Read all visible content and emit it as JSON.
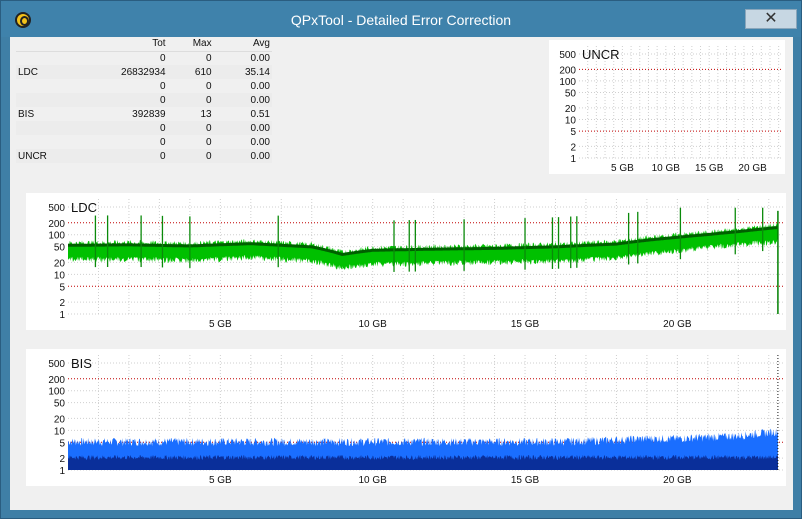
{
  "window": {
    "title": "QPxTool - Detailed Error Correction",
    "close_glyph": "✕",
    "accent": "#3f82ab"
  },
  "stats": {
    "headers": [
      "",
      "Tot",
      "Max",
      "Avg"
    ],
    "rows": [
      [
        "",
        "0",
        "0",
        "0.00"
      ],
      [
        "LDC",
        "26832934",
        "610",
        "35.14"
      ],
      [
        "",
        "0",
        "0",
        "0.00"
      ],
      [
        "",
        "0",
        "0",
        "0.00"
      ],
      [
        "BIS",
        "392839",
        "13",
        "0.51"
      ],
      [
        "",
        "0",
        "0",
        "0.00"
      ],
      [
        "",
        "0",
        "0",
        "0.00"
      ],
      [
        "UNCR",
        "0",
        "0",
        "0.00"
      ]
    ]
  },
  "chart_data": [
    {
      "type": "area",
      "title": "UNCR",
      "y_scale": "log",
      "ylim": [
        1,
        500
      ],
      "yticks": [
        "500",
        "200",
        "100",
        "50",
        "20",
        "10",
        "5",
        "2",
        "1"
      ],
      "xlim_gb": [
        0,
        23.5
      ],
      "xticks": [
        "5 GB",
        "10 GB",
        "15 GB",
        "20 GB"
      ],
      "series": [
        {
          "values": [
            0
          ]
        }
      ],
      "colors": {
        "fill": "#00a000"
      }
    },
    {
      "type": "area",
      "title": "LDC",
      "y_scale": "log",
      "ylim": [
        1,
        500
      ],
      "yticks": [
        "500",
        "200",
        "100",
        "50",
        "20",
        "10",
        "5",
        "2",
        "1"
      ],
      "xlim_gb": [
        0,
        23.5
      ],
      "xticks": [
        "5 GB",
        "10 GB",
        "15 GB",
        "20 GB"
      ],
      "x": [
        0,
        2,
        4,
        6,
        7,
        8,
        9,
        10,
        12,
        14,
        16,
        18,
        19,
        20,
        21,
        22,
        23.3
      ],
      "series": [
        {
          "values": [
            60,
            62,
            58,
            66,
            60,
            55,
            35,
            45,
            48,
            50,
            55,
            65,
            80,
            95,
            110,
            130,
            170
          ]
        },
        {
          "values": [
            40,
            40,
            38,
            44,
            40,
            36,
            24,
            30,
            32,
            34,
            36,
            42,
            55,
            65,
            80,
            95,
            110
          ]
        }
      ],
      "spikes_gb": [
        0.9,
        1.3,
        2.4,
        3.1,
        4.0,
        6.9,
        10.7,
        11.2,
        11.4,
        13.0,
        15.0,
        15.9,
        16.1,
        16.5,
        16.7,
        18.4,
        18.7,
        20.1,
        21.9,
        22.8
      ],
      "colors": {
        "fill": "#00c000",
        "median": "#006000",
        "threshold": "#c00000"
      }
    },
    {
      "type": "area",
      "title": "BIS",
      "y_scale": "log",
      "ylim": [
        1,
        500
      ],
      "yticks": [
        "500",
        "200",
        "100",
        "50",
        "20",
        "10",
        "5",
        "2",
        "1"
      ],
      "xlim_gb": [
        0,
        23.5
      ],
      "xticks": [
        "5 GB",
        "10 GB",
        "15 GB",
        "20 GB"
      ],
      "x": [
        0,
        4,
        8,
        12,
        16,
        18,
        19,
        20,
        21,
        22,
        23.3
      ],
      "series": [
        {
          "values": [
            5,
            5,
            5,
            5,
            5,
            5.5,
            6,
            6,
            6.5,
            7,
            9
          ]
        },
        {
          "values": [
            2,
            2,
            2,
            2,
            2,
            2,
            2,
            2,
            2,
            2,
            2
          ]
        }
      ],
      "colors": {
        "fill": "#1a6eff",
        "dark": "#0a2f9a",
        "threshold": "#c00000"
      }
    }
  ]
}
